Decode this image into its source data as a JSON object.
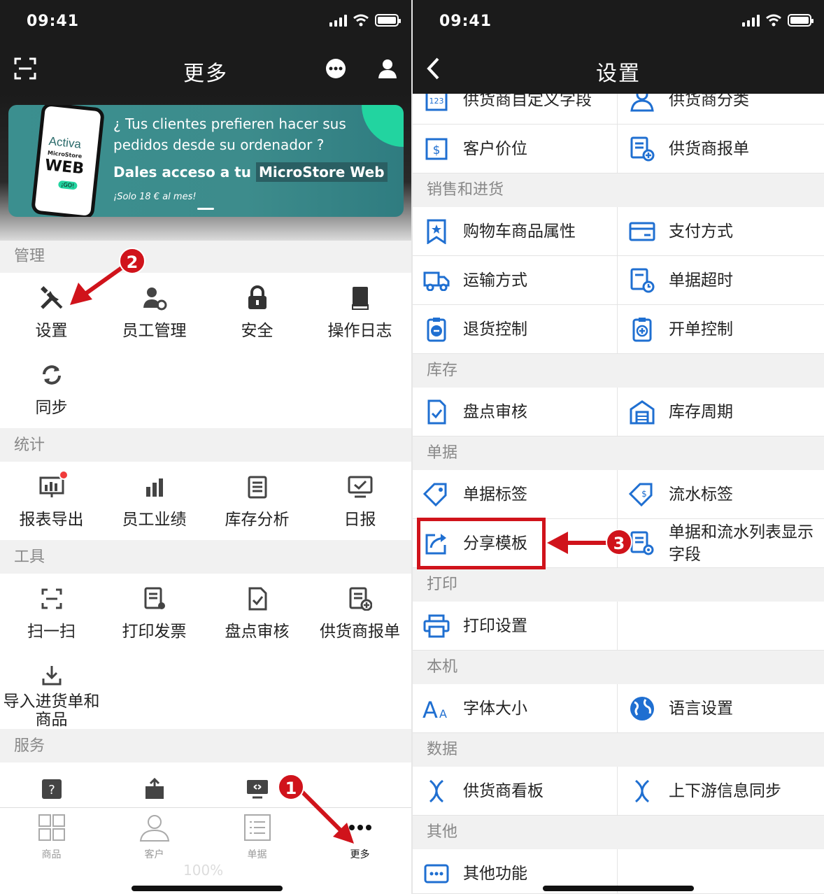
{
  "colors": {
    "accent_blue": "#1f6fd1",
    "annotation_red": "#d0131b",
    "topbar": "#1b1b1b"
  },
  "left": {
    "status": {
      "time": "09:41"
    },
    "nav": {
      "title": "更多",
      "scan_icon": "scan-icon",
      "more_icon": "ellipsis-circle-icon",
      "user_icon": "user-icon"
    },
    "banner": {
      "phone_line1": "Activa",
      "phone_line2": "MicroStore",
      "phone_line3": "WEB",
      "phone_line4": "¡GO!",
      "line1": "¿ Tus clientes prefieren hacer sus pedidos desde su ordenador ?",
      "line2_a": "Dales acceso a tu ",
      "line2_b": "MicroStore Web",
      "line3": "¡Solo 18 € al mes!"
    },
    "sections": {
      "manage": "管理",
      "stats": "统计",
      "tools": "工具",
      "service": "服务"
    },
    "manage_items": [
      "设置",
      "员工管理",
      "安全",
      "操作日志",
      "同步"
    ],
    "stats_items": [
      "报表导出",
      "员工业绩",
      "库存分析",
      "日报"
    ],
    "tools_items": [
      "扫一扫",
      "打印发票",
      "盘点审核",
      "供货商报单",
      "导入进货单和商品"
    ],
    "tabs": [
      "商品",
      "客户",
      "单据",
      "更多"
    ],
    "zoom": "100%",
    "badges": {
      "one": "1",
      "two": "2"
    }
  },
  "right": {
    "status": {
      "time": "09:41"
    },
    "nav": {
      "title": "设置",
      "back_icon": "chevron-left-icon"
    },
    "rows": {
      "r0": [
        "供货商自定义字段",
        "供货商分类"
      ],
      "r1": [
        "客户价位",
        "供货商报单"
      ],
      "h_sales": "销售和进货",
      "r2": [
        "购物车商品属性",
        "支付方式"
      ],
      "r3": [
        "运输方式",
        "单据超时"
      ],
      "r4": [
        "退货控制",
        "开单控制"
      ],
      "h_stock": "库存",
      "r5": [
        "盘点审核",
        "库存周期"
      ],
      "h_docs": "单据",
      "r6": [
        "单据标签",
        "流水标签"
      ],
      "r7": [
        "分享模板",
        "单据和流水列表显示字段"
      ],
      "h_print": "打印",
      "r8": [
        "打印设置"
      ],
      "h_local": "本机",
      "r9": [
        "字体大小",
        "语言设置"
      ],
      "h_data": "数据",
      "r10": [
        "供货商看板",
        "上下游信息同步"
      ],
      "h_other": "其他",
      "r11": [
        "其他功能"
      ]
    },
    "badge_three": "3"
  }
}
